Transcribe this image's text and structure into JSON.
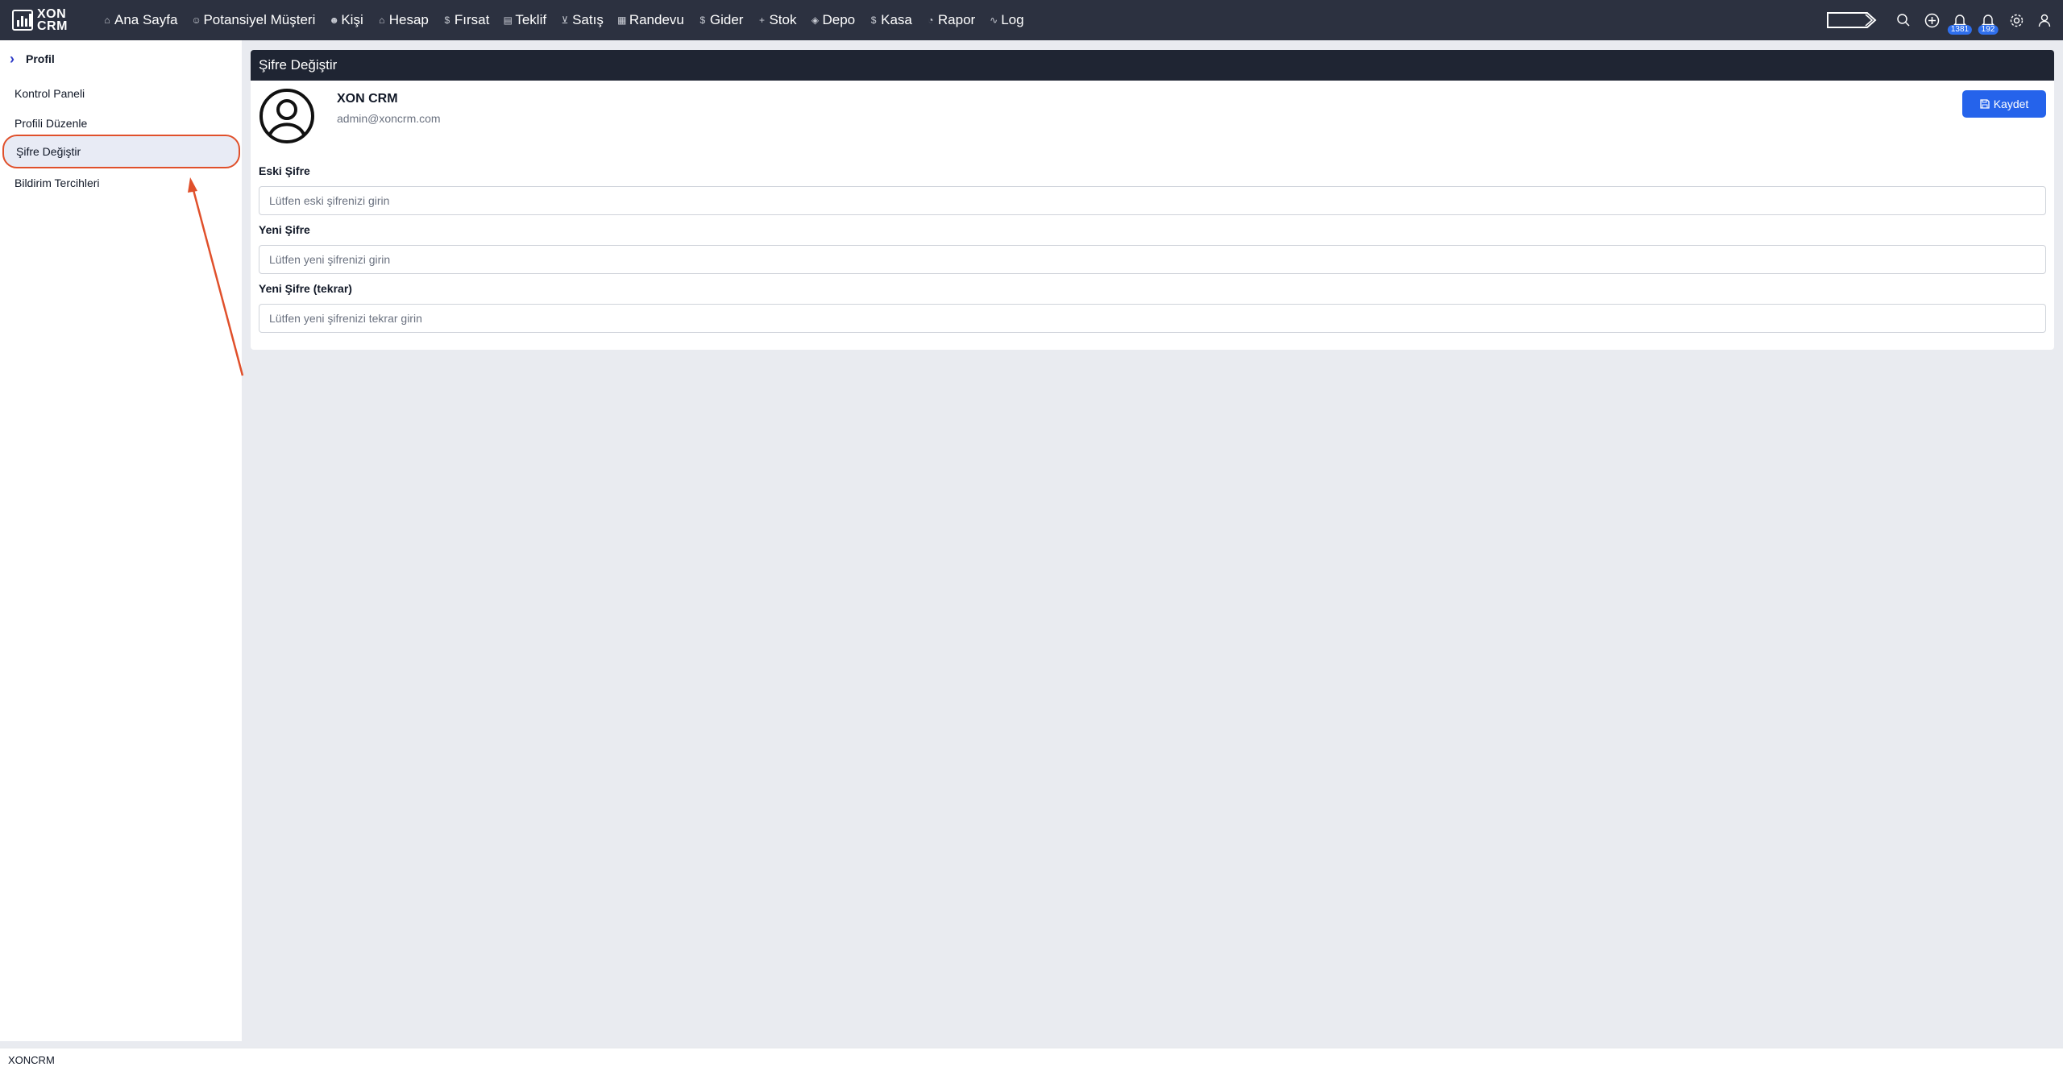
{
  "brand": {
    "logo_line1": "XON",
    "logo_line2": "CRM"
  },
  "nav": [
    {
      "label": "Ana Sayfa",
      "icon": "home-icon",
      "glyph": "⌂"
    },
    {
      "label": "Potansiyel Müşteri",
      "icon": "user-icon",
      "glyph": "☺"
    },
    {
      "label": "Kişi",
      "icon": "users-icon",
      "glyph": "☻"
    },
    {
      "label": "Hesap",
      "icon": "building-icon",
      "glyph": "⌂"
    },
    {
      "label": "Fırsat",
      "icon": "dollar-icon",
      "glyph": "$"
    },
    {
      "label": "Teklif",
      "icon": "document-icon",
      "glyph": "▤"
    },
    {
      "label": "Satış",
      "icon": "cart-icon",
      "glyph": "⊻"
    },
    {
      "label": "Randevu",
      "icon": "calendar-icon",
      "glyph": "▦"
    },
    {
      "label": "Gider",
      "icon": "dollar-icon",
      "glyph": "$"
    },
    {
      "label": "Stok",
      "icon": "plus-icon",
      "glyph": "+"
    },
    {
      "label": "Depo",
      "icon": "box-icon",
      "glyph": "◈"
    },
    {
      "label": "Kasa",
      "icon": "dollar-icon",
      "glyph": "$"
    },
    {
      "label": "Rapor",
      "icon": "pie-chart-icon",
      "glyph": "◔"
    },
    {
      "label": "Log",
      "icon": "activity-icon",
      "glyph": "∿"
    }
  ],
  "topbar_right": {
    "notifications_count": "1381",
    "alerts_count": "192"
  },
  "sidebar": {
    "header": "Profil",
    "items": [
      {
        "label": "Kontrol Paneli"
      },
      {
        "label": "Profili Düzenle"
      },
      {
        "label": "Şifre Değiştir",
        "active": true
      },
      {
        "label": "Bildirim Tercihleri"
      }
    ]
  },
  "panel": {
    "title": "Şifre Değiştir",
    "user_name": "XON CRM",
    "user_email": "admin@xoncrm.com",
    "save_label": "Kaydet",
    "fields": [
      {
        "label": "Eski Şifre",
        "placeholder": "Lütfen eski şifrenizi girin",
        "value": ""
      },
      {
        "label": "Yeni Şifre",
        "placeholder": "Lütfen yeni şifrenizi girin",
        "value": ""
      },
      {
        "label": "Yeni Şifre (tekrar)",
        "placeholder": "Lütfen yeni şifrenizi tekrar girin",
        "value": ""
      }
    ]
  },
  "footer": {
    "text": "XONCRM"
  },
  "colors": {
    "topbar": "#2c3140",
    "panel_header": "#1f2533",
    "primary": "#2563eb",
    "annotation": "#e0502b",
    "background": "#e9ebf0"
  }
}
